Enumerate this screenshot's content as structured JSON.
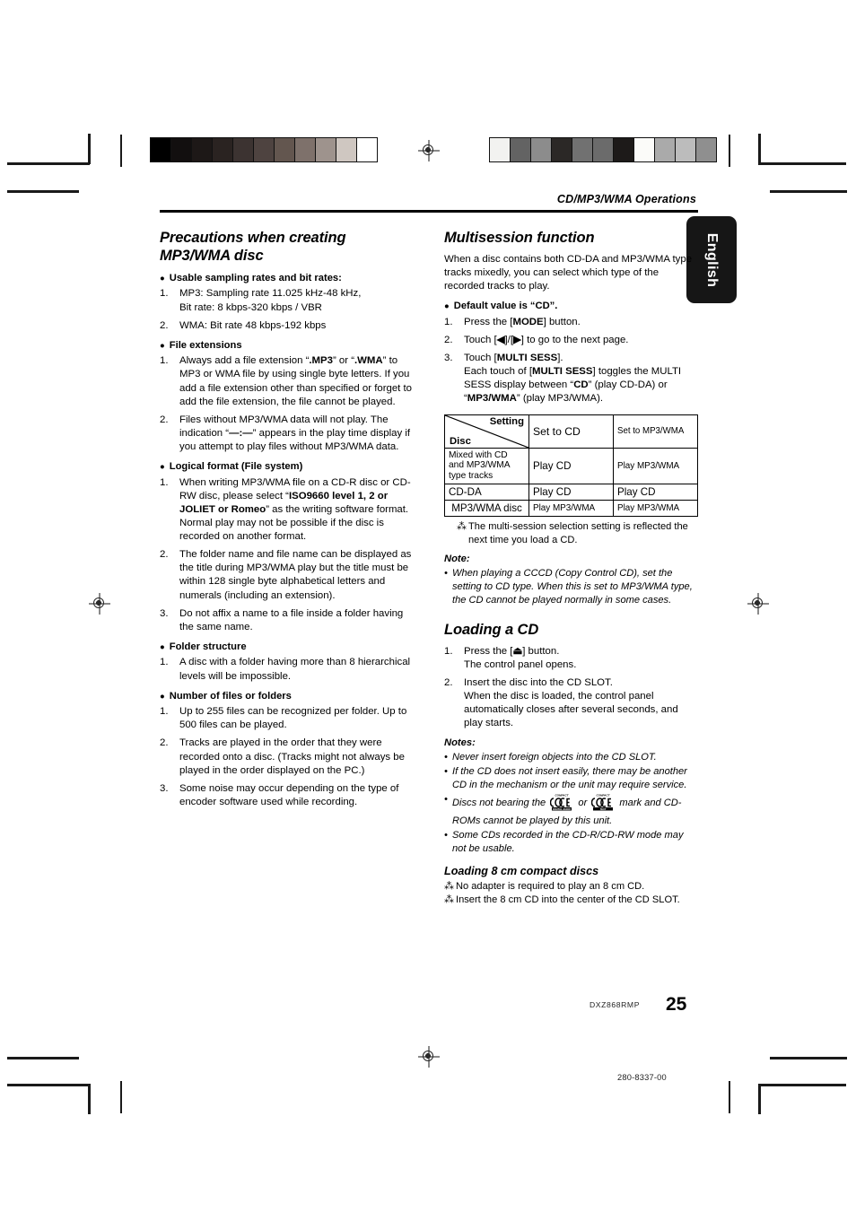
{
  "page": {
    "running_head": "CD/MP3/WMA Operations",
    "language_tab": "English",
    "model_code": "DXZ868RMP",
    "page_number": "25",
    "document_code": "280-8337-00"
  },
  "left_column": {
    "heading": "Precautions when creating MP3/WMA disc",
    "groups": [
      {
        "title": "Usable sampling rates and bit rates:",
        "items": [
          {
            "n": "1.",
            "lines": [
              "MP3: Sampling rate  11.025 kHz-48 kHz,",
              "Bit rate: 8 kbps-320 kbps / VBR"
            ]
          },
          {
            "n": "2.",
            "lines": [
              "WMA: Bit rate 48 kbps-192 kbps"
            ]
          }
        ]
      },
      {
        "title": "File extensions",
        "items": [
          {
            "n": "1.",
            "html": "Always add a file extension “<b>.MP3</b>” or “<b>.WMA</b>” to MP3 or WMA file by using single byte letters. If you add a file extension other than specified or forget to add the file extension, the file cannot be played."
          },
          {
            "n": "2.",
            "html": "Files without MP3/WMA data will not play. The indication “<b>—:—</b>” appears in the play time display if you attempt to play files without MP3/WMA data."
          }
        ]
      },
      {
        "title": "Logical format (File system)",
        "items": [
          {
            "n": "1.",
            "html": "When writing MP3/WMA file on a CD-R disc or CD-RW disc, please select “<b>ISO9660 level 1, 2 or JOLIET or Romeo</b>” as the writing software format. Normal play may not be possible if the disc is recorded on another format."
          },
          {
            "n": "2.",
            "html": "The folder name and file name can be displayed as the title during MP3/WMA play but the title must be within 128 single byte alphabetical letters and numerals (including an extension)."
          },
          {
            "n": "3.",
            "html": "Do not affix a name to a file inside a folder having the same name."
          }
        ]
      },
      {
        "title": "Folder structure",
        "items": [
          {
            "n": "1.",
            "html": "A disc with a folder having more than 8 hierarchical levels will be impossible."
          }
        ]
      },
      {
        "title": "Number of files or folders",
        "items": [
          {
            "n": "1.",
            "html": "Up to 255 files can be recognized per folder. Up to 500 files can be played."
          },
          {
            "n": "2.",
            "html": "Tracks are played in the order that they were recorded onto a disc. (Tracks might not always be played in the order displayed on the PC.)"
          },
          {
            "n": "3.",
            "html": "Some noise may occur depending on the type of encoder software used while recording."
          }
        ]
      }
    ]
  },
  "multisession": {
    "heading": "Multisession function",
    "intro": "When a disc contains both CD-DA and MP3/WMA type tracks mixedly, you can select which type of the recorded tracks to play.",
    "default_label": "Default value is “CD”.",
    "steps": [
      {
        "n": "1.",
        "html": "Press the [<b>MODE</b>] button."
      },
      {
        "n": "2.",
        "html": "Touch [<b>◀</b>]/[<b>▶</b>] to go to the next page."
      },
      {
        "n": "3.",
        "html": "Touch [<b>MULTI SESS</b>].<span class=\"ind\">Each touch of [<b>MULTI SESS</b>] toggles the MULTI SESS display between “<b>CD</b>” (play CD-DA) or “<b>MP3/WMA</b>” (play MP3/WMA).</span>"
      }
    ],
    "table": {
      "corner_setting": "Setting",
      "corner_disc": "Disc",
      "columns": [
        "Set to CD",
        "Set to MP3/WMA"
      ],
      "rows": [
        {
          "disc": "Mixed with CD and MP3/WMA type tracks",
          "set_to_cd": "Play CD",
          "set_to_mp3wma": "Play MP3/WMA"
        },
        {
          "disc": "CD-DA",
          "set_to_cd": "Play CD",
          "set_to_mp3wma": "Play CD"
        },
        {
          "disc": "MP3/WMA disc",
          "set_to_cd": "Play MP3/WMA",
          "set_to_mp3wma": "Play MP3/WMA"
        }
      ]
    },
    "star_note": "The multi-session selection setting is reflected the next time you load a CD.",
    "note_label": "Note:",
    "notes": [
      "When playing a CCCD (Copy Control CD), set the setting to CD type. When this is set to MP3/WMA type, the CD cannot be played normally in some cases."
    ]
  },
  "loading_cd": {
    "heading": "Loading a CD",
    "steps": [
      {
        "n": "1.",
        "html": "Press the [<b>⏏</b>] button.<span class=\"ind\">The control panel opens.</span>"
      },
      {
        "n": "2.",
        "html": "Insert the disc into the CD SLOT.<span class=\"ind\">When the disc is loaded, the control panel automatically closes after several seconds, and play starts.</span>"
      }
    ],
    "notes_label": "Notes:",
    "notes": [
      {
        "html": "Never insert foreign objects into the CD SLOT."
      },
      {
        "html": "If the CD does not insert easily, there may be another CD in the mechanism or the unit may require service."
      },
      {
        "html": "Discs not bearing the __CDLOGO1__ or __CDLOGO2__ mark and CD-ROMs cannot be played by this unit."
      },
      {
        "html": "Some CDs recorded in the CD-R/CD-RW mode may not be usable."
      }
    ],
    "logo1_alt": "Compact Disc Digital Audio",
    "logo2_alt": "Compact Disc Text",
    "subheading": "Loading 8 cm compact discs",
    "star_notes": [
      "No adapter is required to play an 8 cm CD.",
      "Insert the 8 cm CD into the center of the CD SLOT."
    ]
  },
  "calibration": {
    "left_strip": [
      "#000000",
      "#120f0f",
      "#1d1817",
      "#2a2321",
      "#3c3331",
      "#4e4340",
      "#63564f",
      "#7e716b",
      "#9e938d",
      "#cfc7c1",
      "#ffffff"
    ],
    "right_strip": [
      "#f2f2f0",
      "#636363",
      "#8c8c8c",
      "#2b2826",
      "#717171",
      "#6b6b6b",
      "#1d1a19",
      "#fbfbf9",
      "#aaaaaa",
      "#bcbcbc",
      "#8f8f8f"
    ]
  }
}
